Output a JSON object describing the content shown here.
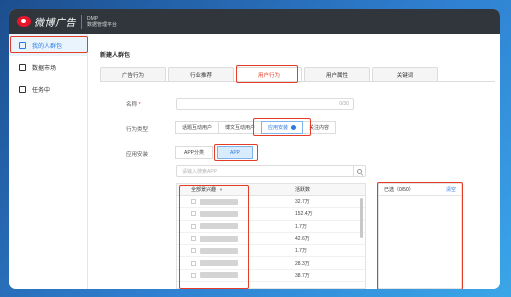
{
  "header": {
    "brand": "微博广告",
    "dmp": "DMP",
    "platform": "数据管理平台"
  },
  "sidebar": {
    "items": [
      {
        "label": "我的人群包",
        "icon": "user-group-icon",
        "active": true
      },
      {
        "label": "数据市场",
        "icon": "database-icon",
        "active": false
      },
      {
        "label": "任务中",
        "icon": "task-list-icon",
        "active": false
      }
    ]
  },
  "main": {
    "title": "新建人群包",
    "tabs": [
      "广告行为",
      "行业推荐",
      "用户行为",
      "用户属性",
      "关键词"
    ],
    "active_tab": "用户行为",
    "form": {
      "name_label": "名称",
      "name_required": "*",
      "name_count": "0/30",
      "behavior_label": "行为类型",
      "behavior_options": [
        "话题互动用户",
        "博文互动用户",
        "应用安装",
        "关注内容"
      ],
      "behavior_selected": "应用安装",
      "app_label": "应用安装",
      "app_options": [
        "APP分类",
        "APP"
      ],
      "app_selected": "APP",
      "search_placeholder": "请输入搜索APP"
    },
    "table": {
      "columns": [
        "全部景兴趣",
        "活跃数"
      ],
      "rows": [
        {
          "value": "32.7万"
        },
        {
          "value": "152.4万"
        },
        {
          "value": "1.7万"
        },
        {
          "value": "42.6万"
        },
        {
          "value": "1.7万"
        },
        {
          "value": "28.3万"
        },
        {
          "value": "38.7万"
        }
      ]
    },
    "selected_panel": {
      "title": "已选（0/50）",
      "clear": "清空"
    }
  },
  "colors": {
    "accent": "#2c7be5",
    "highlight": "#e53b27",
    "topbar": "#31363d"
  }
}
